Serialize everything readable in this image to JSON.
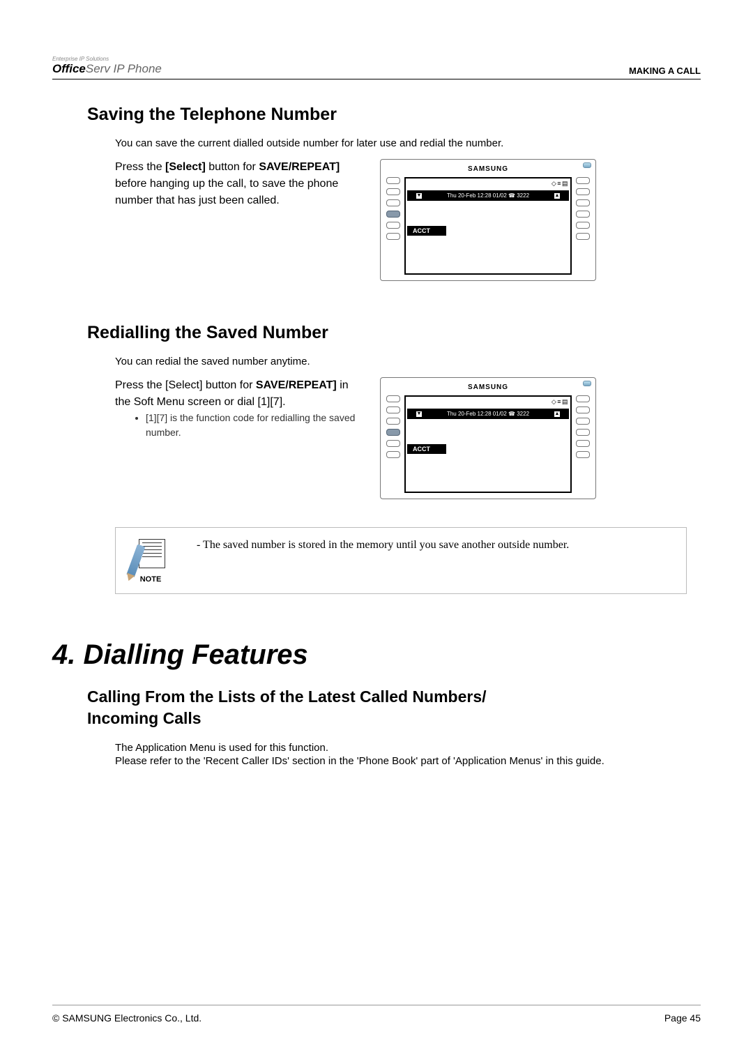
{
  "header": {
    "brand_small": "Enterprise IP Solutions",
    "brand_bold": "Office",
    "brand_light": "Serv IP Phone",
    "right": "MAKING A CALL"
  },
  "sec1": {
    "title": "Saving the Telephone Number",
    "intro": "You can save the current dialled outside number for later use and redial the number.",
    "instruction_pre": "Press the ",
    "instruction_b1": "[Select]",
    "instruction_mid": " button for ",
    "instruction_b2": "SAVE/REPEAT]",
    "instruction_post": " before hanging up the call, to save the phone number that has just been called."
  },
  "sec2": {
    "title": "Redialling the Saved Number",
    "intro": "You can redial the saved number anytime.",
    "instruction_pre": "Press the [Select] button for ",
    "instruction_b1": "SAVE/REPEAT]",
    "instruction_post": " in the Soft Menu screen or dial [1][7].",
    "bullet": "[1][7] is the function code for redialling the saved number."
  },
  "phone": {
    "logo": "SAMSUNG",
    "status_icons": "◇ ≡ ▤",
    "row_text": "Thu 20-Feb 12:28 01/02 ☎ 3222",
    "acct": "ACCT"
  },
  "note": {
    "label": "NOTE",
    "text": "- The saved number is stored in the memory until you save another outside number."
  },
  "chap": {
    "title": "4. Dialling Features",
    "sub_l1": "Calling From the Lists of the Latest Called Numbers/",
    "sub_l2": "Incoming Calls",
    "p1": "The Application Menu is used for this function.",
    "p2": "Please refer to the 'Recent Caller IDs' section in the 'Phone Book' part of 'Application Menus' in this guide."
  },
  "footer": {
    "left": "© SAMSUNG Electronics Co., Ltd.",
    "right": "Page 45"
  }
}
